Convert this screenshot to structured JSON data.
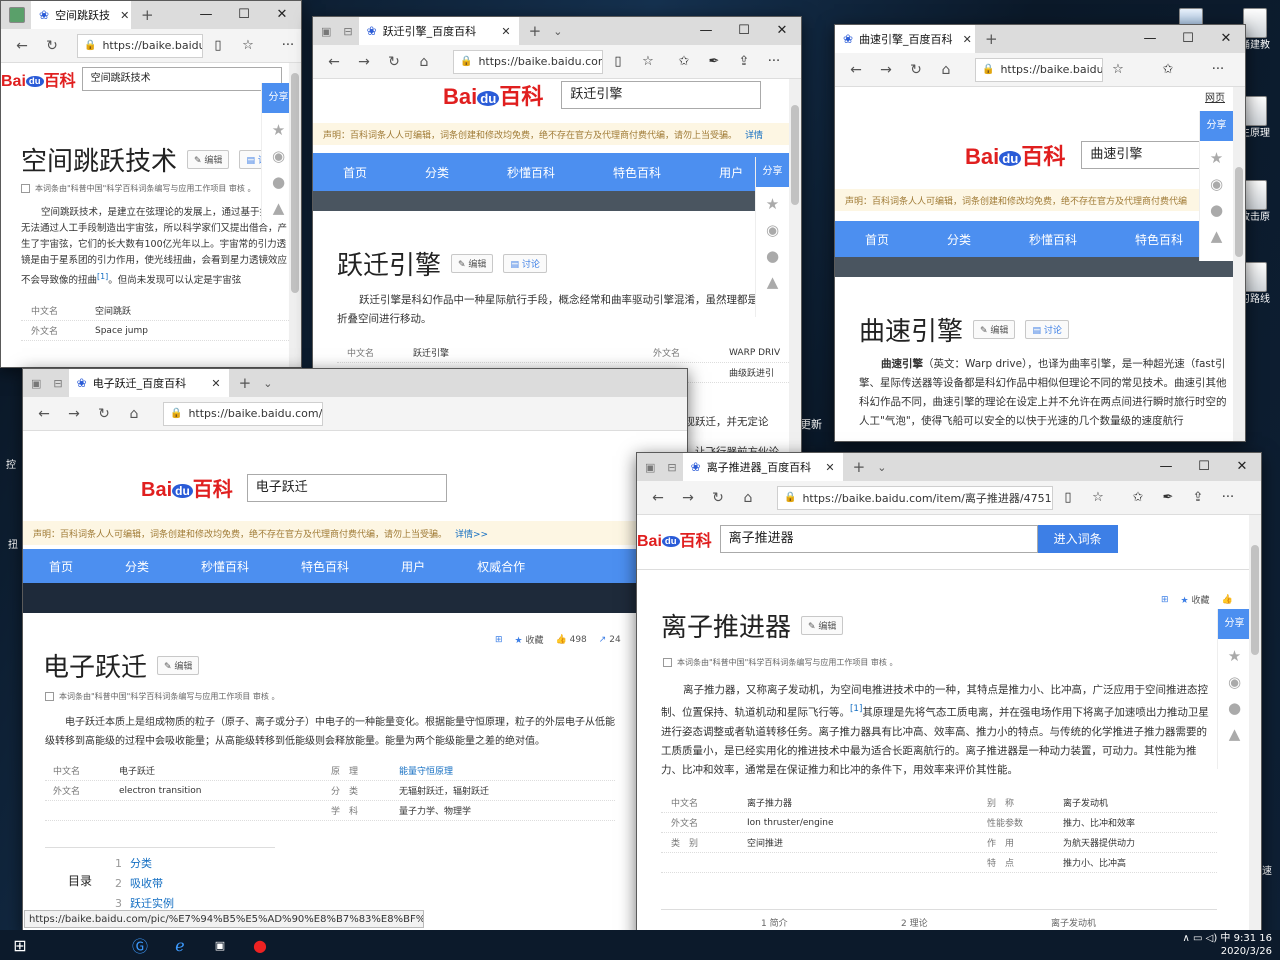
{
  "desktop": {
    "icons": [
      {
        "label": "",
        "variant": "doc"
      },
      {
        "label": "",
        "variant": "doc"
      },
      {
        "label": "",
        "variant": "doc"
      },
      {
        "label": "",
        "variant": "doc"
      },
      {
        "label": "",
        "variant": "doc"
      }
    ],
    "edge_texts": [
      "踊建教",
      "生原理",
      "改击原",
      "理",
      "习路线",
      "更新",
      "控",
      "扭",
      "速"
    ]
  },
  "win1": {
    "tab_title": "空间跳跃技",
    "url": "https://baike.baidu.cc",
    "search_value": "空间跳跃技术",
    "page_title": "空间跳跃技术",
    "edit": "编辑",
    "discuss": "讨论",
    "badge": "4",
    "note": "本词条由\"科普中国\"科学百科词条编写与应用工作项目 审核 。",
    "body": "空间跳跃技术，是建立在弦理论的发展上，通过基于技术，无法通过人工手段制造出宇宙弦，所以科学家们又提出借合，产生了宇宙弦，它们的长大数有100亿光年以上。宇宙常的引力透镜是由于星系团的引力作用，使光线扭曲，会看到星力透镜效应不会导致像的扭曲",
    "cite": "[1]",
    "body_tail": "。但尚未发现可以认定是宇宙弦",
    "info": [
      {
        "k": "中文名",
        "v": "空间跳跃"
      },
      {
        "k": "外文名",
        "v": "Space jump"
      }
    ],
    "share": "分享"
  },
  "win2": {
    "tab_title": "跃迁引擎_百度百科",
    "url": "https://baike.baidu.com/it",
    "search_value": "跃迁引擎",
    "notice": "声明：百科词条人人可编辑，词条创建和修改均免费，绝不存在官方及代理商付费代编，请勿上当受骗。",
    "notice_link": "详情",
    "nav": [
      "首页",
      "分类",
      "秒懂百科",
      "特色百科",
      "用户"
    ],
    "page_title": "跃迁引擎",
    "edit": "编辑",
    "discuss": "讨论",
    "body": "跃迁引擎是科幻作品中一种星际航行手段，概念经常和曲率驱动引擎混淆，虽然理都是通过折叠空间进行移动。",
    "info": [
      {
        "k": "中文名",
        "v": "跃迁引擎",
        "k2": "外文名",
        "v2": "WARP DRIV"
      },
      {
        "k": "",
        "v": "",
        "k2": "别　名",
        "v2": "曲级跃进引"
      }
    ],
    "para1": "由于概念均出科幻作品中，所以没有准确的定义。而现实中是否可以实现跃迁，并无定论",
    "para2": "其实所谓的飞行，飞行器所处空间是相对静止的。要做的事是采用方法，让飞行器前方伙论上的超光速飞行。",
    "share": "分享"
  },
  "win3": {
    "tab_title": "曲速引擎_百度百科",
    "url": "https://baike.baidu.c",
    "web_link": "网页",
    "search_value": "曲速引擎",
    "notice": "声明：百科词条人人可编辑，词条创建和修改均免费，绝不存在官方及代理商付费代编",
    "nav": [
      "首页",
      "分类",
      "秒懂百科",
      "特色百科"
    ],
    "page_title": "曲速引擎",
    "edit": "编辑",
    "discuss": "讨论",
    "body_bold": "曲速引擎",
    "body": "（英文：Warp drive），也译为曲率引擎，是一种超光速（fast引擎、星际传送器等设备都是科幻作品中相似但理论不同的常见技术。曲速引其他科幻作品不同，曲速引擎的理论在设定上并不允许在两点间进行瞬时旅行时空的人工\"气泡\"，使得飞船可以安全的以快于光速的几个数量级的速度航行",
    "share": "分享"
  },
  "win4": {
    "tab_title": "电子跃迁_百度百科",
    "url": "https://baike.baidu.com/it",
    "search_value": "电子跃迁",
    "enter": "进入词条",
    "notice": "声明：百科词条人人可编辑，词条创建和修改均免费，绝不存在官方及代理商付费代编，请勿上当受骗。",
    "notice_link": "详情>>",
    "nav": [
      "首页",
      "分类",
      "秒懂百科",
      "特色百科",
      "用户",
      "权威合作"
    ],
    "page_title": "电子跃迁",
    "edit": "编辑",
    "favorite": "收藏",
    "likes": "498",
    "shares": "24",
    "note": "本词条由\"科普中国\"科学百科词条编写与应用工作项目 审核 。",
    "body": "电子跃迁本质上是组成物质的粒子（原子、离子或分子）中电子的一种能量变化。根据能量守恒原理，粒子的外层电子从低能级转移到高能级的过程中会吸收能量；从高能级转移到低能级则会释放能量。能量为两个能级能量之差的绝对值。",
    "info": [
      {
        "k": "中文名",
        "v": "电子跃迁",
        "k2": "原　理",
        "v2": "能量守恒原理"
      },
      {
        "k": "外文名",
        "v": "electron transition",
        "k2": "分　类",
        "v2": "无辐射跃迁，辐射跃迁"
      },
      {
        "k": "",
        "v": "",
        "k2": "学　科",
        "v2": "量子力学、物理学"
      }
    ],
    "toc_title": "目录",
    "toc": [
      {
        "n": "1",
        "t": "分类"
      },
      {
        "n": "2",
        "t": "吸收带"
      },
      {
        "n": "3",
        "t": "跃迁实例"
      }
    ],
    "status_url": "https://baike.baidu.com/pic/%E7%94%B5%E5%AD%90%E8%B7%83%E8%BF%81/11036485/0"
  },
  "win5": {
    "tab_title": "离子推进器_百度百科",
    "url": "https://baike.baidu.com/item/离子推进器/4751870?fr=al",
    "search_value": "离子推进器",
    "enter": "进入词条",
    "favorite": "收藏",
    "page_title": "离子推进器",
    "edit": "编辑",
    "note": "本词条由\"科普中国\"科学百科词条编写与应用工作项目 审核 。",
    "body": "离子推力器，又称离子发动机，为空间电推进技术中的一种，其特点是推力小、比冲高，广泛应用于空间推进态控制、位置保持、轨道机动和星际飞行等。",
    "cite": "[1]",
    "body2": "其原理是先将气态工质电离，并在强电场作用下将离子加速喷出力推动卫星进行姿态调整或者轨道转移任务。离子推力器具有比冲高、效率高、推力小的特点。与传统的化学推进子推力器需要的工质质量小，是已经实用化的推进技术中最为适合长距离航行的。离子推进器是一种动力装置，可动力。其性能为推力、比冲和效率，通常是在保证推力和比冲的条件下，用效率来评价其性能。",
    "info": [
      {
        "k": "中文名",
        "v": "离子推力器",
        "k2": "别　称",
        "v2": "离子发动机"
      },
      {
        "k": "外文名",
        "v": "Ion thruster/engine",
        "k2": "性能参数",
        "v2": "推力、比冲和效率"
      },
      {
        "k": "类　别",
        "v": "空间推进",
        "k2": "作　用",
        "v2": "为航天器提供动力"
      },
      {
        "k": "",
        "v": "",
        "k2": "特　点",
        "v2": "推力小、比冲高"
      }
    ],
    "bottom": [
      "1 简介",
      "2 理论",
      "离子发动机"
    ],
    "share": "分享"
  },
  "taskbar": {
    "date": "2020/3/26",
    "time": "9:31",
    "lang": "中",
    "badge": "16"
  },
  "colors": {
    "baidu_red": "#e01f1f",
    "baidu_blue": "#2a5bd7",
    "nav_blue": "#4c8ff0",
    "link": "#136ec2"
  }
}
